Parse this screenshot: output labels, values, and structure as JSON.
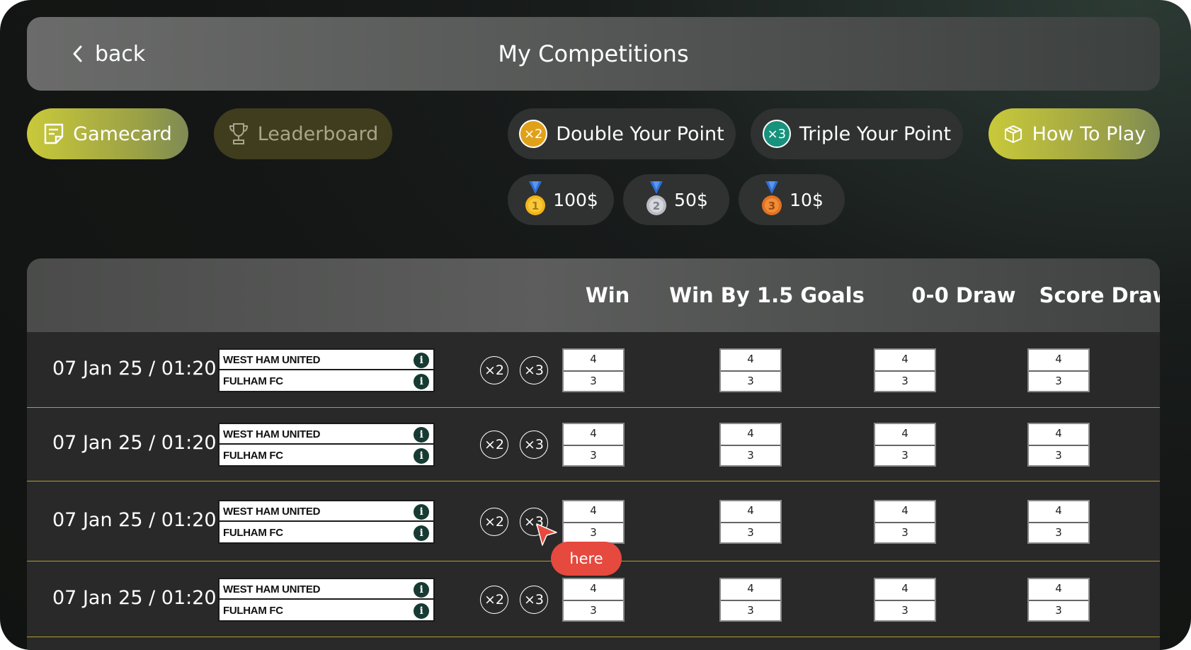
{
  "header": {
    "back_label": "back",
    "title": "My Competitions"
  },
  "toolbar": {
    "gamecard_label": "Gamecard",
    "leaderboard_label": "Leaderboard",
    "double_label": "Double Your Point",
    "double_badge": "×2",
    "triple_label": "Triple Your Point",
    "triple_badge": "×3",
    "howto_label": "How To Play"
  },
  "prizes": [
    {
      "label": "100$",
      "medal": "gold-medal-icon"
    },
    {
      "label": "50$",
      "medal": "silver-medal-icon"
    },
    {
      "label": "10$",
      "medal": "bronze-medal-icon"
    }
  ],
  "table": {
    "columns": [
      "Win",
      "Win By 1.5 Goals",
      "0-0 Draw",
      "Score Draw"
    ],
    "rows": [
      {
        "date": "07 Jan 25 / 01:20",
        "home": "WEST HAM UNITED",
        "away": "FULHAM FC",
        "x2": "×2",
        "x3": "×3",
        "odds": [
          [
            "4",
            "3"
          ],
          [
            "4",
            "3"
          ],
          [
            "4",
            "3"
          ],
          [
            "4",
            "3"
          ]
        ]
      },
      {
        "date": "07 Jan 25 / 01:20",
        "home": "WEST HAM UNITED",
        "away": "FULHAM FC",
        "x2": "×2",
        "x3": "×3",
        "odds": [
          [
            "4",
            "3"
          ],
          [
            "4",
            "3"
          ],
          [
            "4",
            "3"
          ],
          [
            "4",
            "3"
          ]
        ]
      },
      {
        "date": "07 Jan 25 / 01:20",
        "home": "WEST HAM UNITED",
        "away": "FULHAM FC",
        "x2": "×2",
        "x3": "×3",
        "odds": [
          [
            "4",
            "3"
          ],
          [
            "4",
            "3"
          ],
          [
            "4",
            "3"
          ],
          [
            "4",
            "3"
          ]
        ]
      },
      {
        "date": "07 Jan 25 / 01:20",
        "home": "WEST HAM UNITED",
        "away": "FULHAM FC",
        "x2": "×2",
        "x3": "×3",
        "odds": [
          [
            "4",
            "3"
          ],
          [
            "4",
            "3"
          ],
          [
            "4",
            "3"
          ],
          [
            "4",
            "3"
          ]
        ]
      }
    ],
    "info_glyph": "i"
  },
  "tooltip": {
    "label": "here"
  },
  "colors": {
    "accent_yellow": "#c9c93a",
    "double_gold": "#e0a11a",
    "triple_teal": "#17927d",
    "row_divider": "#b79a2c",
    "tooltip_red": "#e6493e"
  }
}
